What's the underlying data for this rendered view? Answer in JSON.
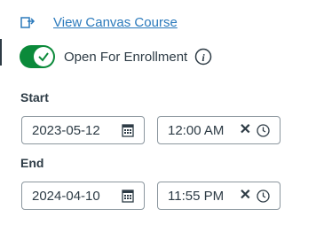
{
  "link": {
    "icon": "external-link-icon",
    "label": "View Canvas Course"
  },
  "enrollment": {
    "toggle_on": true,
    "label": "Open For Enrollment",
    "info_icon": "info-icon"
  },
  "start": {
    "label": "Start",
    "date": "2023-05-12",
    "time": "12:00 AM"
  },
  "end": {
    "label": "End",
    "date": "2024-04-10",
    "time": "11:55 PM"
  },
  "colors": {
    "link": "#2b7abc",
    "toggle_on": "#0b8a3a",
    "text": "#2d3b45",
    "border": "#8b969e"
  }
}
